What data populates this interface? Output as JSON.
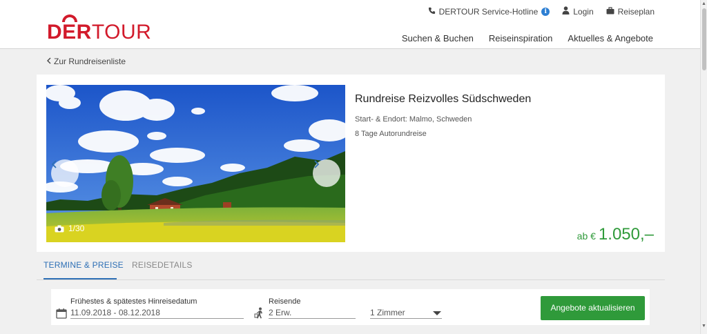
{
  "header": {
    "logo": {
      "der": "DER",
      "tour": "TOUR"
    },
    "utility": {
      "hotline": "DERTOUR Service-Hotline",
      "hotline_info": "i",
      "login": "Login",
      "travel_plan": "Reiseplan"
    },
    "nav": [
      "Suchen & Buchen",
      "Reiseinspiration",
      "Aktuelles & Angebote"
    ]
  },
  "back_link": "Zur Rundreisenliste",
  "tour": {
    "title": "Rundreise Reizvolles Südschweden",
    "route": "Start- & Endort: Malmo, Schweden",
    "duration": "8 Tage Autorundreise",
    "price_prefix": "ab €",
    "price": "1.050,–",
    "photo_counter": "1/30"
  },
  "tabs": [
    {
      "label": "TERMINE & PREISE",
      "active": true
    },
    {
      "label": "REISEDETAILS",
      "active": false
    }
  ],
  "filters": {
    "date_label": "Frühestes & spätestes Hinreisedatum",
    "date_value": "11.09.2018 - 08.12.2018",
    "travelers_label": "Reisende",
    "travelers_value": "2 Erw.",
    "rooms_value": "1 Zimmer",
    "update_button": "Angebote aktualisieren"
  },
  "colors": {
    "brand": "#d21a2b",
    "accent": "#2d6fb5",
    "price": "#2f9a3a",
    "button": "#2f9a3a"
  }
}
